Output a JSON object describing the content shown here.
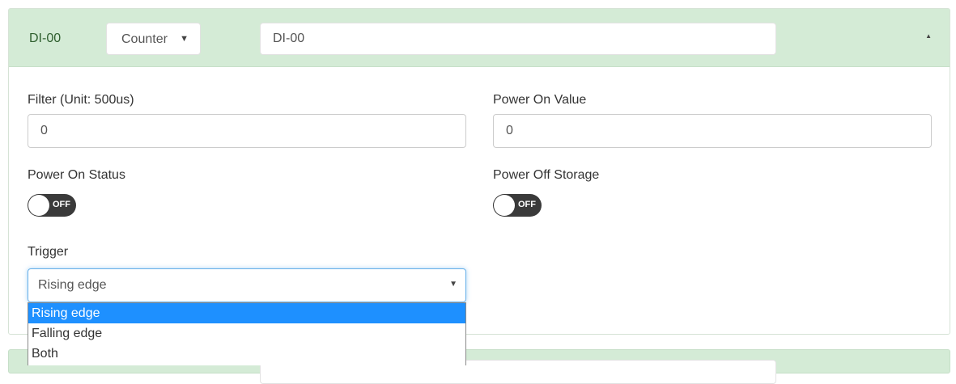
{
  "header": {
    "channel_name": "DI-00",
    "mode_value": "Counter",
    "name_value": "DI-00"
  },
  "fields": {
    "filter_label": "Filter (Unit: 500us)",
    "filter_value": "0",
    "power_on_value_label": "Power On Value",
    "power_on_value": "0",
    "power_on_status_label": "Power On Status",
    "power_on_status_toggle": "OFF",
    "power_off_storage_label": "Power Off Storage",
    "power_off_storage_toggle": "OFF",
    "trigger_label": "Trigger",
    "trigger_value": "Rising edge"
  },
  "trigger_options": [
    "Rising edge",
    "Falling edge",
    "Both"
  ],
  "colors": {
    "header_bg": "#d4ebd6",
    "toggle_bg": "#3a3a3a",
    "selected_option": "#1e90ff"
  },
  "icons": {
    "mode_caret": "▼",
    "collapse": "▲",
    "trigger_caret": "▼"
  }
}
